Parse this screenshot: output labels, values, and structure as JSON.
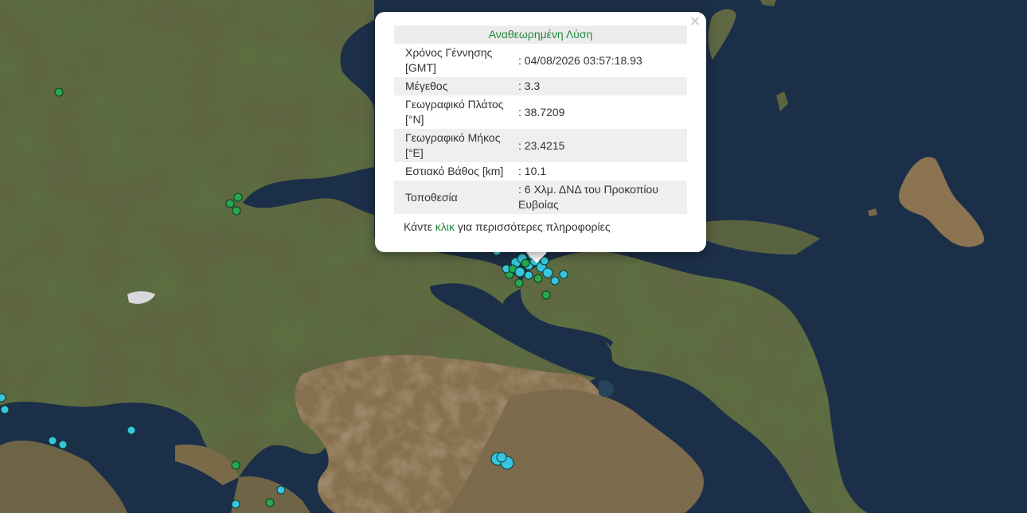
{
  "popup": {
    "title": "Αναθεωρημένη Λύση",
    "close_symbol": "×",
    "rows": [
      {
        "label": "Χρόνος Γέννησης [GMT]",
        "value": ": 04/08/2026 03:57:18.93"
      },
      {
        "label": "Μέγεθος",
        "value": ": 3.3"
      },
      {
        "label": "Γεωγραφικό Πλάτος [°N]",
        "value": ": 38.7209"
      },
      {
        "label": "Γεωγραφικό Μήκος [°E]",
        "value": ": 23.4215"
      },
      {
        "label": "Εστιακό Βάθος [km]",
        "value": ": 10.1"
      },
      {
        "label": "Τοποθεσία",
        "value": ": 6 Χλμ. ΔΝΔ του Προκοπίου Ευβοίας"
      }
    ],
    "more_prefix": "Κάντε ",
    "more_link": "κλικ",
    "more_suffix": " για περισσότερες πληροφορίες"
  },
  "colors": {
    "sea": "#1b2d46",
    "land": "#6b6a46",
    "marker_cyan": "#36c6e0",
    "marker_green": "#27a84a",
    "title_green": "#1f8a3a"
  }
}
